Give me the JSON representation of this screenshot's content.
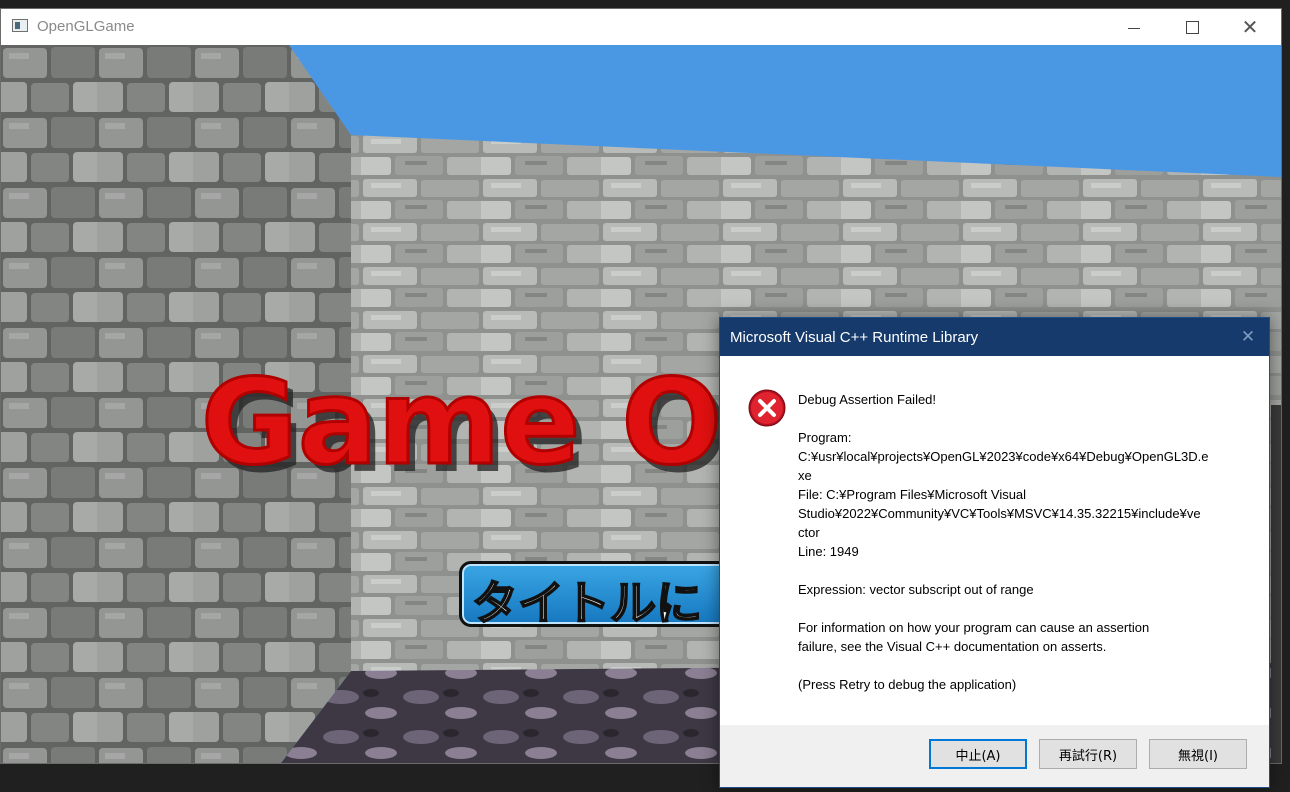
{
  "window": {
    "title": "OpenGLGame",
    "minimize_glyph": "—",
    "maximize_glyph": "☐",
    "close_glyph": "✕"
  },
  "scene": {
    "sky_color": "#4a98e4",
    "banner_text": "Game O",
    "banner_color": "#e01010",
    "button_label": "タイトルに"
  },
  "dialog": {
    "title": "Microsoft Visual C++ Runtime Library",
    "close_glyph": "✕",
    "icon": "error-icon",
    "heading": "Debug Assertion Failed!",
    "program_label": "Program:",
    "program_path_1": "C:¥usr¥local¥projects¥OpenGL¥2023¥code¥x64¥Debug¥OpenGL3D.e",
    "program_path_2": "xe",
    "file_line_1": "File: C:¥Program Files¥Microsoft Visual",
    "file_line_2": "Studio¥2022¥Community¥VC¥Tools¥MSVC¥14.35.32215¥include¥ve",
    "file_line_3": "ctor",
    "line": "Line: 1949",
    "expression": "Expression: vector subscript out of range",
    "info_1": "For information on how your program can cause an assertion",
    "info_2": "failure, see the Visual C++ documentation on asserts.",
    "hint": "(Press Retry to debug the application)",
    "buttons": {
      "abort": "中止(A)",
      "retry": "再試行(R)",
      "ignore": "無視(I)"
    }
  }
}
